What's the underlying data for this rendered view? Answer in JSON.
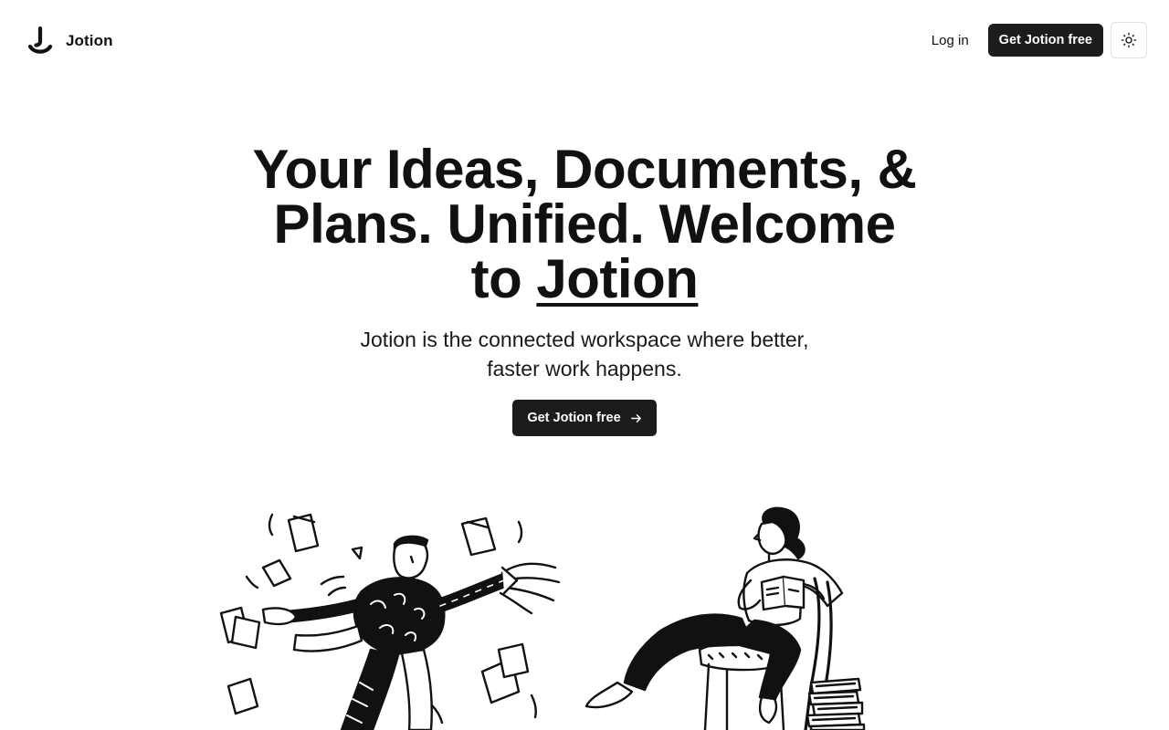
{
  "header": {
    "brand_name": "Jotion",
    "login_label": "Log in",
    "cta_label": "Get Jotion free",
    "theme_icon": "sun-icon"
  },
  "hero": {
    "title_line_a": "Your Ideas, Documents, &",
    "title_line_b": "Plans. Unified. Welcome",
    "title_to": "to",
    "title_brand": "Jotion",
    "subtitle": "Jotion is the connected workspace where better, faster work happens.",
    "cta_label": "Get Jotion free",
    "cta_icon": "arrow-right-icon"
  },
  "illustrations": {
    "left_icon": "person-throwing-papers-illustration",
    "right_icon": "person-reading-illustration"
  },
  "colors": {
    "background": "#ffffff",
    "text": "#111111",
    "button": "#1c1c1c",
    "button_text": "#ffffff",
    "border": "#e2e2e2"
  }
}
